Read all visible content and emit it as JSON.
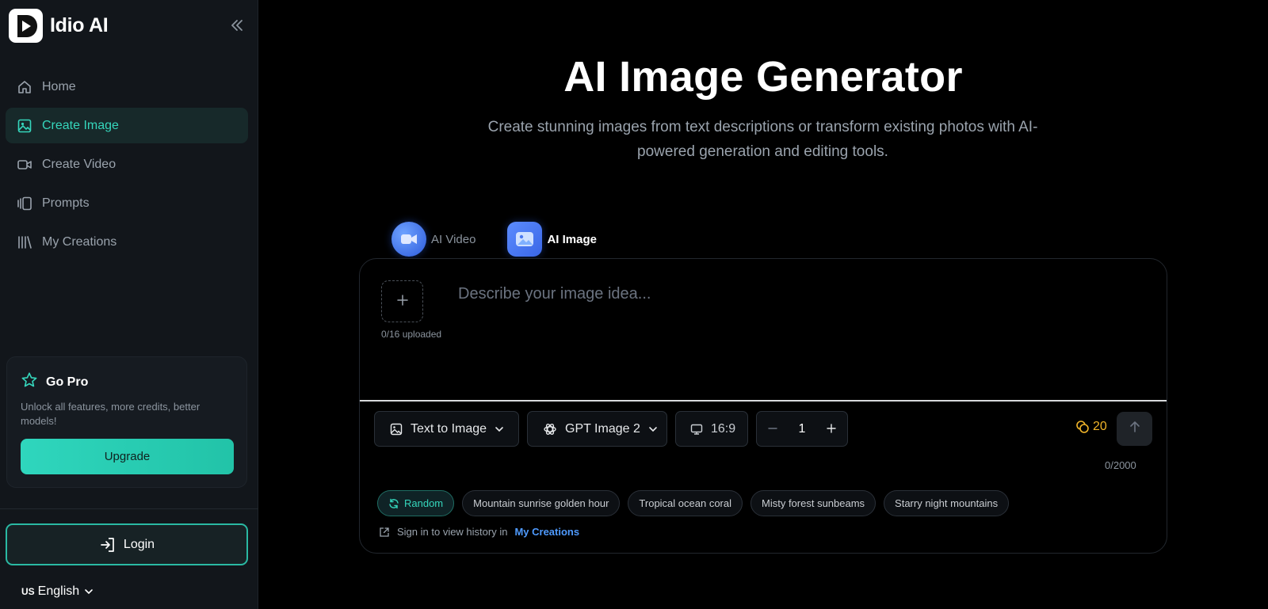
{
  "app": {
    "name": "Idio AI"
  },
  "sidebar": {
    "items": [
      {
        "label": "Home",
        "icon": "home-icon"
      },
      {
        "label": "Create Image",
        "icon": "image-icon",
        "active": true
      },
      {
        "label": "Create Video",
        "icon": "video-icon"
      },
      {
        "label": "Prompts",
        "icon": "prompts-icon"
      },
      {
        "label": "My Creations",
        "icon": "library-icon"
      }
    ],
    "pro": {
      "title": "Go Pro",
      "description": "Unlock all features, more credits, better models!",
      "button": "Upgrade"
    },
    "login": "Login",
    "language": {
      "flag": "US",
      "label": "English"
    }
  },
  "hero": {
    "title": "AI Image Generator",
    "subtitle": "Create stunning images from text descriptions or transform existing photos with AI-powered generation and editing tools."
  },
  "tabs": [
    {
      "label": "AI Video"
    },
    {
      "label": "AI Image",
      "active": true
    }
  ],
  "composer": {
    "upload_count": "0/16 uploaded",
    "placeholder": "Describe your image idea...",
    "mode": "Text to Image",
    "model": "GPT Image 2",
    "ratio": "16:9",
    "quantity": "1",
    "credits": "20",
    "char_count": "0/2000",
    "random_label": "Random",
    "suggestions": [
      "Mountain sunrise golden hour",
      "Tropical ocean coral",
      "Misty forest sunbeams",
      "Starry night mountains"
    ],
    "history_text": "Sign in to view history in",
    "history_link": "My Creations"
  },
  "colors": {
    "accent": "#35d6bc",
    "credits": "#f0b429",
    "link": "#4f9bff",
    "background": "#000000",
    "sidebar": "#12161b"
  }
}
